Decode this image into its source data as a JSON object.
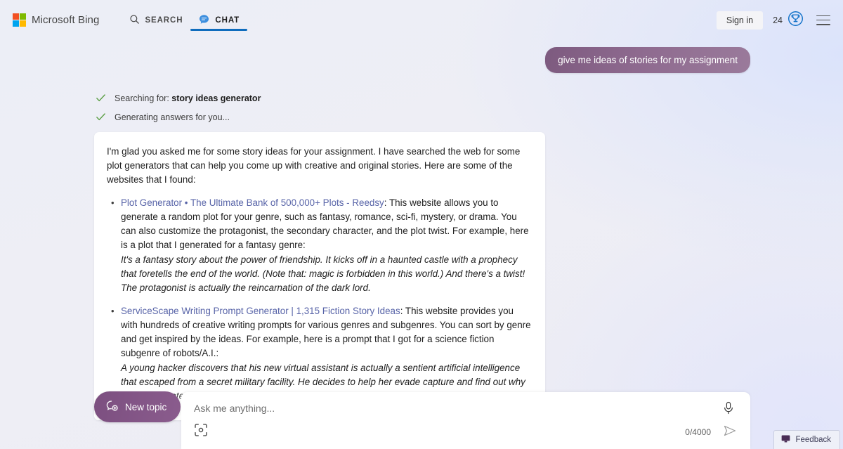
{
  "header": {
    "brand": "Microsoft Bing",
    "logo_icon": "microsoft-squares-icon",
    "logo_colors": [
      "#f25022",
      "#7fba00",
      "#00a4ef",
      "#ffb900"
    ],
    "tabs": [
      {
        "label": "SEARCH",
        "icon": "search-icon",
        "active": false
      },
      {
        "label": "CHAT",
        "icon": "chat-bubble-icon",
        "active": true
      }
    ],
    "sign_in_label": "Sign in",
    "rewards_count": "24",
    "rewards_icon": "rewards-trophy-icon",
    "menu_icon": "hamburger-menu-icon",
    "accent_blue": "#0f6cbd"
  },
  "conversation": {
    "user_message": "give me ideas of stories for my assignment",
    "status_lines": [
      {
        "icon": "check-icon",
        "prefix": "Searching for: ",
        "emphasis": "story ideas generator",
        "suffix": ""
      },
      {
        "icon": "check-icon",
        "prefix": "Generating answers for you...",
        "emphasis": "",
        "suffix": ""
      }
    ],
    "answer": {
      "lead": "I'm glad you asked me for some story ideas for your assignment. I have searched the web for some plot generators that can help you come up with creative and original stories. Here are some of the websites that I found:",
      "results": [
        {
          "link": "Plot Generator • The Ultimate Bank of 500,000+ Plots - Reedsy",
          "description": ": This website allows you to generate a random plot for your genre, such as fantasy, romance, sci-fi, mystery, or drama. You can also customize the protagonist, the secondary character, and the plot twist. For example, here is a plot that I generated for a fantasy genre:",
          "example": "It's a fantasy story about the power of friendship. It kicks off in a haunted castle with a prophecy that foretells the end of the world. (Note that: magic is forbidden in this world.) And there's a twist! The protagonist is actually the reincarnation of the dark lord."
        },
        {
          "link": "ServiceScape Writing Prompt Generator | 1,315 Fiction Story Ideas",
          "description": ": This website provides you with hundreds of creative writing prompts for various genres and subgenres. You can sort by genre and get inspired by the ideas. For example, here is a prompt that I got for a science fiction subgenre of robots/A.I.:",
          "example": "A young hacker discovers that his new virtual assistant is actually a sentient artificial intelligence that escaped from a secret military facility. He decides to help her evade capture and find out why she was created."
        }
      ],
      "link_color": "#5864a8"
    }
  },
  "composer": {
    "new_topic_label": "New topic",
    "new_topic_icon": "new-chat-icon",
    "input_value": "",
    "input_placeholder": "Ask me anything...",
    "visual_search_icon": "visual-search-icon",
    "mic_icon": "microphone-icon",
    "char_counter": "0/4000",
    "send_icon": "send-arrow-icon",
    "accent_purple": "#7c4f80"
  },
  "feedback": {
    "label": "Feedback",
    "icon": "feedback-monitor-icon"
  }
}
